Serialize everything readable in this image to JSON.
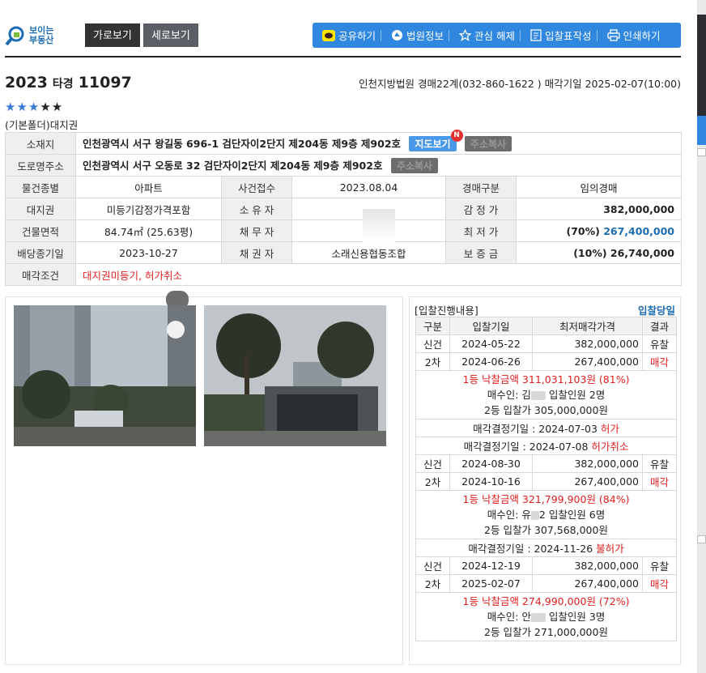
{
  "logo": {
    "line1": "보이는",
    "line2": "부동산"
  },
  "view": {
    "horizontal": "가로보기",
    "vertical": "세로보기"
  },
  "toolbar": {
    "share": "공유하기",
    "court_info": "법원정보",
    "unwatch": "관심 해제",
    "bid_form": "입찰표작성",
    "print": "인쇄하기"
  },
  "case": {
    "year": "2023",
    "type": "타경",
    "number": "11097"
  },
  "court_line": "인천지방법원 경매22계(032-860-1622 ) 매각기일 2025-02-07(10:00)",
  "rating": {
    "filled": 3,
    "total": 5,
    "stars_on": "★★★",
    "stars_off": "★★"
  },
  "folder": "(기본폴더)대지권",
  "info": {
    "address_label": "소재지",
    "address": "인천광역시 서구 왕길동 696-1 검단자이2단지 제204동 제9층 제902호",
    "map_button": "지도보기",
    "map_badge": "N",
    "copy_button": "주소복사",
    "road_label": "도로명주소",
    "road_address": "인천광역시 서구 오동로 32 검단자이2단지 제204동 제9층 제902호",
    "rows": [
      {
        "h1": "물건종별",
        "v1": "아파트",
        "h2": "사건접수",
        "v2": "2023.08.04",
        "h3": "경매구분",
        "v3": "임의경매"
      },
      {
        "h1": "대지권",
        "v1": "미등기감정가격포함",
        "h2": "소 유 자",
        "v2": "",
        "h3": "감 정 가",
        "v3": "382,000,000"
      },
      {
        "h1": "건물면적",
        "v1": "84.74㎡ (25.63평)",
        "h2": "채 무 자",
        "v2": "",
        "h3": "최 저 가",
        "v3a": "(70%)",
        "v3b": "267,400,000"
      },
      {
        "h1": "배당종기일",
        "v1": "2023-10-27",
        "h2": "채 권 자",
        "v2": "소래신용협동조합",
        "h3": "보 증 금",
        "v3": "(10%) 26,740,000"
      }
    ],
    "condition_label": "매각조건",
    "condition": "대지권미등기, 허가취소"
  },
  "bids": {
    "title": "[입찰진행내용]",
    "today_link": "입찰당일",
    "headers": [
      "구분",
      "입찰기일",
      "최저매각가격",
      "결과"
    ],
    "r1": {
      "kind": "신건",
      "date": "2024-05-22",
      "price": "382,000,000",
      "result": "유찰"
    },
    "r2": {
      "kind": "2차",
      "date": "2024-06-26",
      "price": "267,400,000",
      "result": "매각"
    },
    "w1": {
      "win": "1등 낙찰금액 311,031,103원 (81%)",
      "buyer_a": "매수인: 김",
      "buyer_b": " 입찰인원 2명",
      "second": "2등 입찰가 305,000,000원"
    },
    "d1": {
      "label": "매각결정기일 : 2024-07-03 ",
      "status": "허가"
    },
    "d2": {
      "label": "매각결정기일 : 2024-07-08 ",
      "status": "허가취소"
    },
    "r3": {
      "kind": "신건",
      "date": "2024-08-30",
      "price": "382,000,000",
      "result": "유찰"
    },
    "r4": {
      "kind": "2차",
      "date": "2024-10-16",
      "price": "267,400,000",
      "result": "매각"
    },
    "w2": {
      "win": "1등 낙찰금액 321,799,900원 (84%)",
      "buyer_a": "매수인: 유",
      "buyer_b": "2 입찰인원 6명",
      "second": "2등 입찰가 307,568,000원"
    },
    "d3": {
      "label": "매각결정기일 : 2024-11-26 ",
      "status": "불허가"
    },
    "r5": {
      "kind": "신건",
      "date": "2024-12-19",
      "price": "382,000,000",
      "result": "유찰"
    },
    "r6": {
      "kind": "2차",
      "date": "2025-02-07",
      "price": "267,400,000",
      "result": "매각"
    },
    "w3": {
      "win": "1등 낙찰금액 274,990,000원 (72%)",
      "buyer_a": "매수인: 안",
      "buyer_b": " 입찰인원 3명",
      "second": "2등 입찰가 271,000,000원"
    }
  },
  "colors": {
    "accent": "#2f87e0",
    "highlight": "#e02020",
    "link": "#1d6db3"
  }
}
